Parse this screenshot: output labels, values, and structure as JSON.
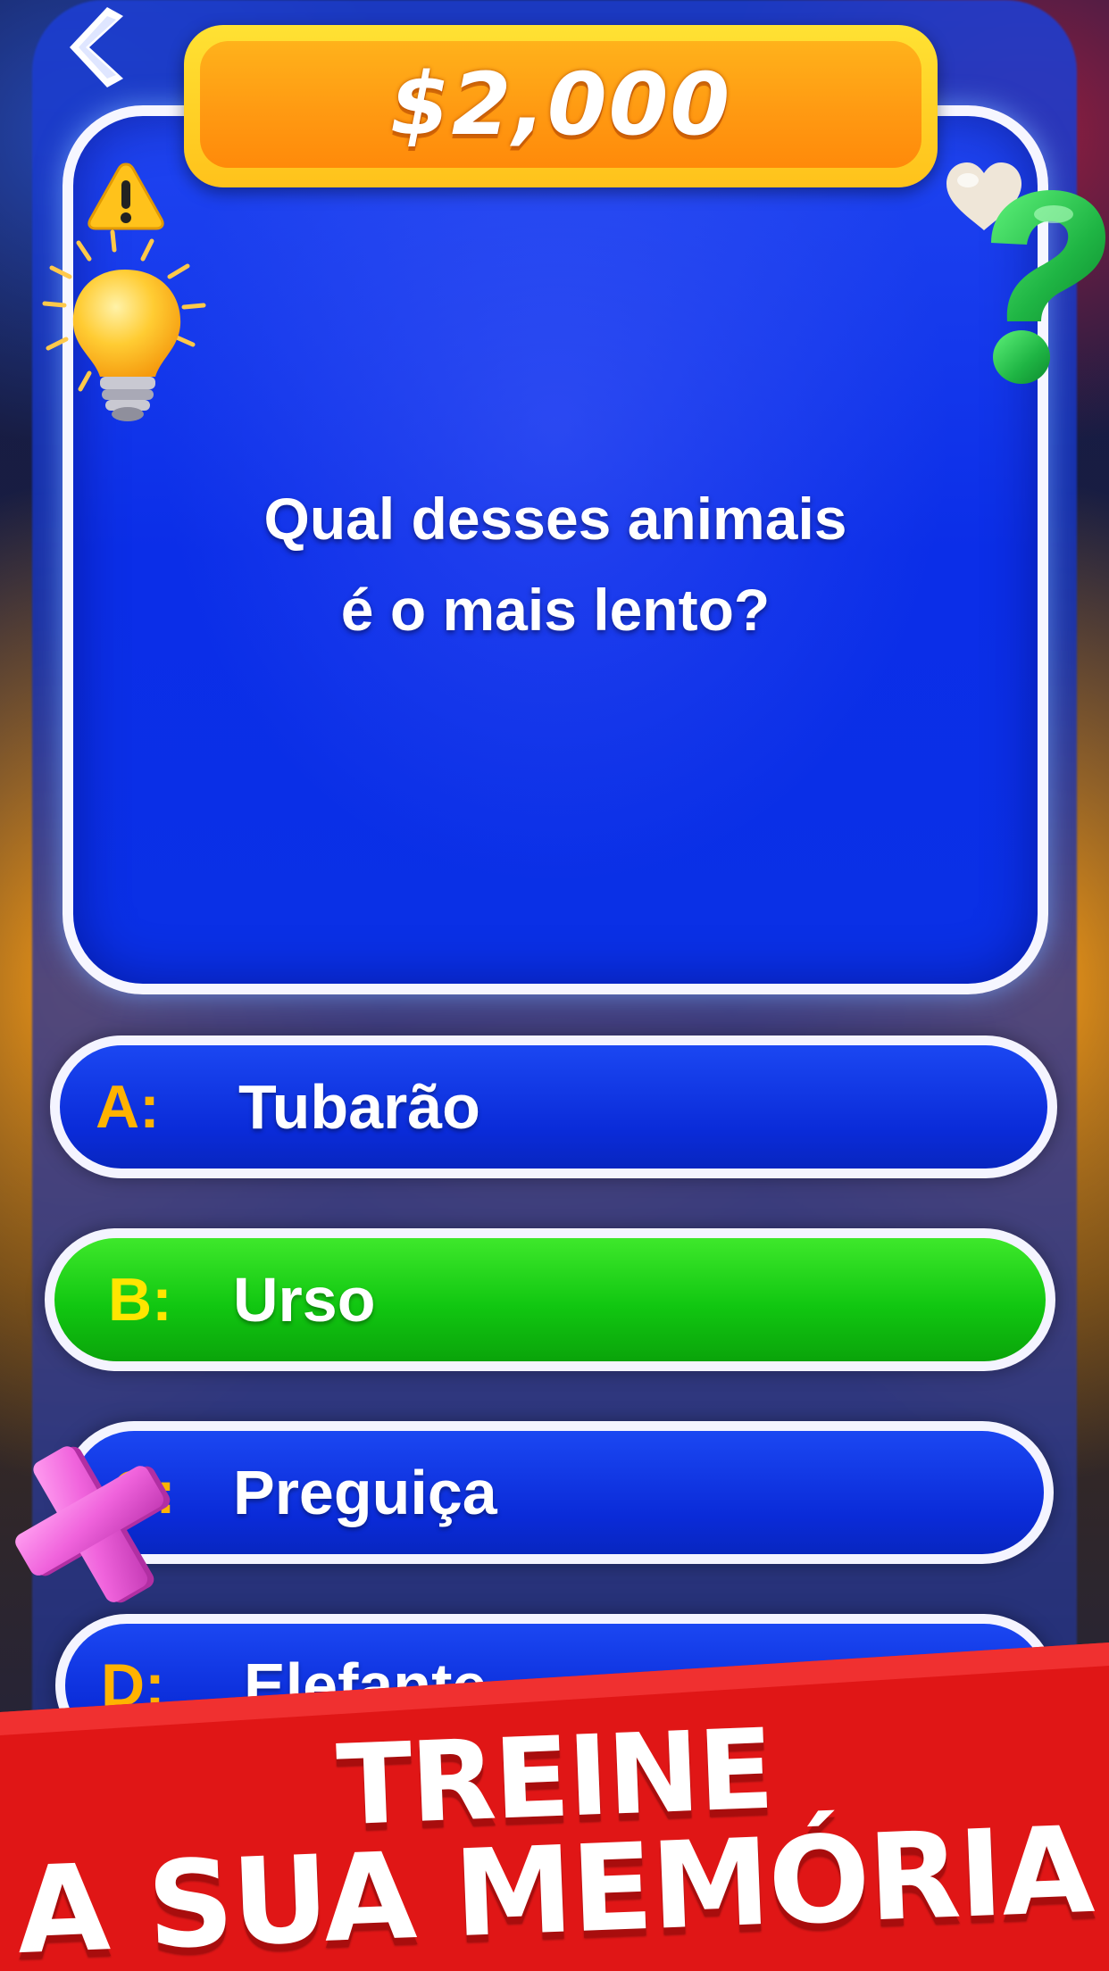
{
  "header": {
    "prize": "$2,000"
  },
  "question": {
    "line1": "Qual desses animais",
    "line2": "é o mais lento?"
  },
  "answers": [
    {
      "letter": "A:",
      "text": "Tubarão",
      "state": "default"
    },
    {
      "letter": "B:",
      "text": "Urso",
      "state": "selected"
    },
    {
      "letter": "C:",
      "text": "Preguiça",
      "state": "default"
    },
    {
      "letter": "D:",
      "text": "Elefante",
      "state": "default"
    }
  ],
  "promo": {
    "line1": "TREINE",
    "line2": "A SUA MEMÓRIA"
  },
  "icons": {
    "back": "back-chevron-icon",
    "warning": "warning-icon",
    "bulb": "lightbulb-icon",
    "heart": "heart-icon",
    "question": "question-mark-icon",
    "cross": "cross-icon"
  },
  "colors": {
    "card_blue": "#0a30e6",
    "answer_green": "#11c711",
    "prize_orange": "#ff9a12",
    "prize_yellow": "#ffd21f",
    "letter_orange": "#ffb300",
    "banner_red": "#e01616"
  }
}
